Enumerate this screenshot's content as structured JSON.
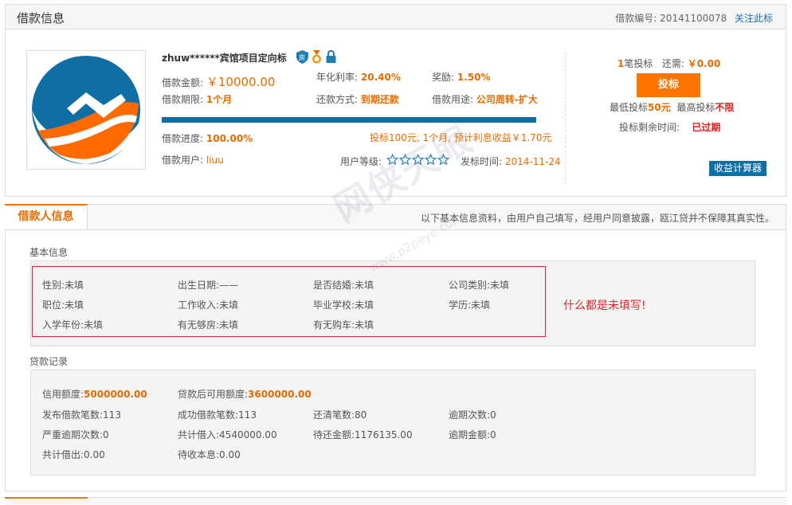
{
  "loan": {
    "panel_title": "借款信息",
    "loan_no_label": "借款编号:",
    "loan_no": "20141100078",
    "follow_label": "关注此标",
    "title": "zhuw******宾馆项目定向标",
    "amount_label": "借款金额:",
    "amount": "￥10000.00",
    "rate_label": "年化利率:",
    "rate": "20.40%",
    "reward_label": "奖励:",
    "reward": "1.50%",
    "term_label": "借款期限:",
    "term": "1个月",
    "repay_label": "还款方式:",
    "repay": "到期还款",
    "purpose_label": "借款用途:",
    "purpose": "公司周转-扩大",
    "progress_label": "借款进度:",
    "progress": "100.00%",
    "progress_fraction": 1.0,
    "profit_note": "投标100元, 1个月, 预计利息收益￥1.70元",
    "user_label": "借款用户:",
    "user": "liuu",
    "level_label": "用户等级:",
    "level_stars": 5,
    "publish_label": "发标时间:",
    "publish_time": "2014-11-24",
    "bids_count": "1",
    "bids_suffix": "笔投标",
    "need_label": "还需:",
    "need_value": "￥0.00",
    "bid_button": "投标",
    "min_bid_label": "最低投标",
    "min_bid": "50元",
    "max_bid_label": "最高投标",
    "max_bid": "不限",
    "remaining_label": "投标剩余时间:",
    "remaining": "已过期",
    "calc_button": "收益计算器"
  },
  "borrower": {
    "tab_label": "借款人信息",
    "note": "以下基本信息资料，由用户自己填写，经用户同意披露，瓯江贷并不保障其真实性。",
    "basic_title": "基本信息",
    "basic": [
      {
        "label": "性别:",
        "value": "未填"
      },
      {
        "label": "出生日期:",
        "value": "——"
      },
      {
        "label": "是否结婚:",
        "value": "未填"
      },
      {
        "label": "公司类别:",
        "value": "未填"
      },
      {
        "label": "职位:",
        "value": "未填"
      },
      {
        "label": "工作收入:",
        "value": "未填"
      },
      {
        "label": "毕业学校:",
        "value": "未填"
      },
      {
        "label": "学历:",
        "value": "未填"
      },
      {
        "label": "入学年份:",
        "value": "未填"
      },
      {
        "label": "有无够房:",
        "value": "未填"
      },
      {
        "label": "有无购车:",
        "value": "未填"
      }
    ],
    "annotation": "什么都是未填写!",
    "loan_record_title": "贷款记录",
    "records": [
      {
        "label": "信用额度:",
        "value": "5000000.00"
      },
      {
        "label": "贷款后可用额度:",
        "value": "3600000.00"
      },
      {
        "label": "发布借款笔数:",
        "value": "113"
      },
      {
        "label": "成功借款笔数:",
        "value": "113"
      },
      {
        "label": "还清笔数:",
        "value": "80"
      },
      {
        "label": "逾期次数:",
        "value": "0"
      },
      {
        "label": "严重逾期次数:",
        "value": "0"
      },
      {
        "label": "共计借入:",
        "value": "4540000.00"
      },
      {
        "label": "待还金额:",
        "value": "1176135.00"
      },
      {
        "label": "逾期金额:",
        "value": "0"
      },
      {
        "label": "共计借出:",
        "value": "0.00"
      },
      {
        "label": "待收本息:",
        "value": "0.00"
      }
    ]
  },
  "watermark": {
    "text": "网侠天眼",
    "url": "www.p2peye.com"
  },
  "colors": {
    "accent": "#ff7300",
    "value": "#e56b00",
    "blue": "#0f6fa5",
    "annotation": "#d9252a"
  },
  "icons": [
    "shield-icon",
    "medal-icon",
    "lock-icon",
    "star-icon"
  ]
}
